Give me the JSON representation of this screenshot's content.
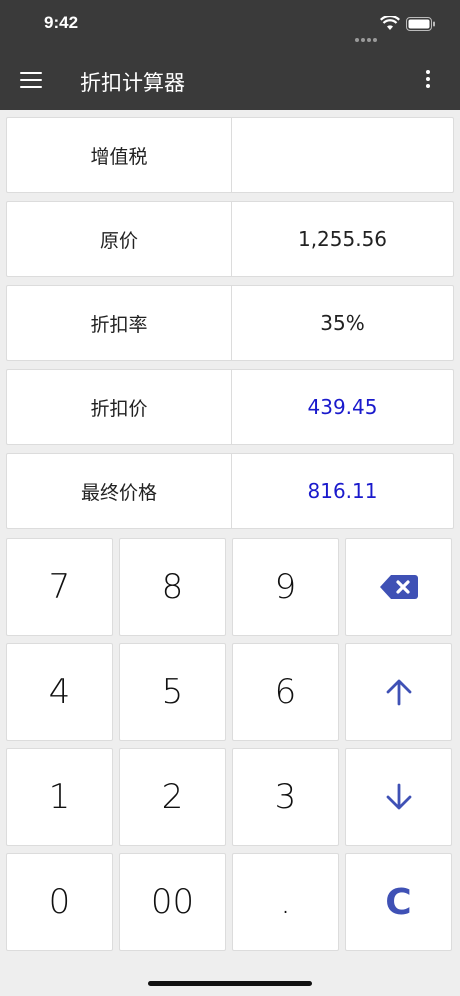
{
  "status": {
    "time": "9:42"
  },
  "app": {
    "title": "折扣计算器"
  },
  "rows": [
    {
      "label": "增值税",
      "value": ""
    },
    {
      "label": "原价",
      "value": "1,255.56"
    },
    {
      "label": "折扣率",
      "value": "35%"
    },
    {
      "label": "折扣价",
      "value": "439.45"
    },
    {
      "label": "最终价格",
      "value": "816.11"
    }
  ],
  "keypad": {
    "k7": "7",
    "k8": "8",
    "k9": "9",
    "k4": "4",
    "k5": "5",
    "k6": "6",
    "k1": "1",
    "k2": "2",
    "k3": "3",
    "k0": "0",
    "k00": "00",
    "kdot": ".",
    "clear": "C"
  },
  "colors": {
    "bar": "#3a3a3a",
    "accent": "#3f51b5",
    "result": "#1a1acc",
    "background": "#eeeeee"
  },
  "icons": [
    "menu-icon",
    "more-vert-icon",
    "backspace-icon",
    "arrow-up-icon",
    "arrow-down-icon",
    "wifi-icon",
    "battery-icon"
  ]
}
